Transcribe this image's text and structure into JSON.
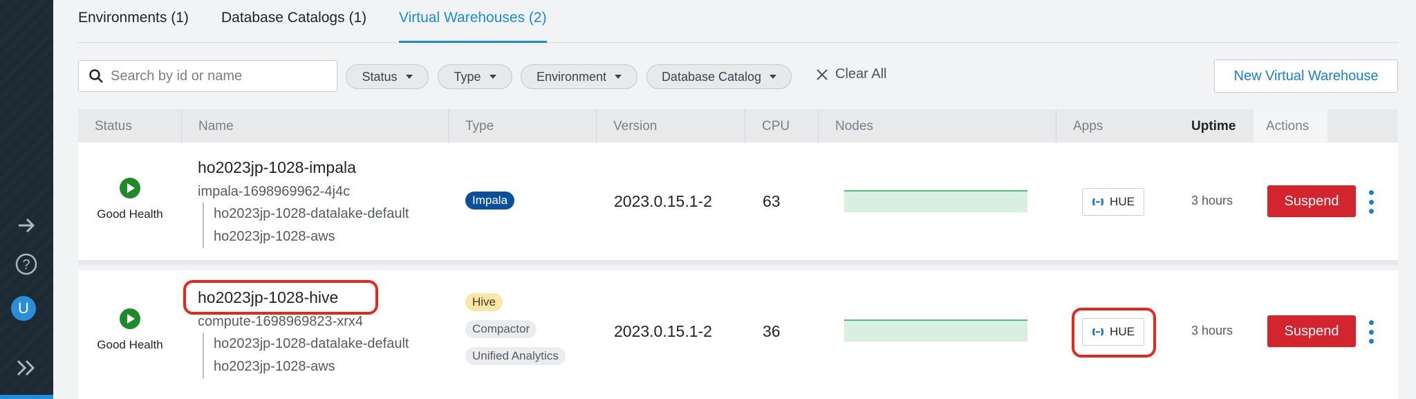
{
  "tabs": [
    "Environments (1)",
    "Database Catalogs (1)",
    "Virtual Warehouses (2)"
  ],
  "search": {
    "placeholder": "Search by id or name"
  },
  "filters": [
    "Status",
    "Type",
    "Environment",
    "Database Catalog"
  ],
  "clear_all_label": "Clear All",
  "new_vw_label": "New Virtual Warehouse",
  "columns": [
    "Status",
    "Name",
    "Type",
    "Version",
    "CPU",
    "Nodes",
    "Apps",
    "Uptime",
    "Actions"
  ],
  "rows": [
    {
      "health": "Good Health",
      "name": "ho2023jp-1028-impala",
      "id": "impala-1698969962-4j4c",
      "links": [
        "ho2023jp-1028-datalake-default",
        "ho2023jp-1028-aws"
      ],
      "types": [
        "Impala"
      ],
      "version": "2023.0.15.1-2",
      "cpu": "63",
      "app": "HUE",
      "uptime": "3 hours",
      "action": "Suspend"
    },
    {
      "health": "Good Health",
      "name": "ho2023jp-1028-hive",
      "id": "compute-1698969823-xrx4",
      "links": [
        "ho2023jp-1028-datalake-default",
        "ho2023jp-1028-aws"
      ],
      "types": [
        "Hive",
        "Compactor",
        "Unified Analytics"
      ],
      "version": "2023.0.15.1-2",
      "cpu": "36",
      "app": "HUE",
      "uptime": "3 hours",
      "action": "Suspend"
    }
  ],
  "avatar_initial": "U",
  "colors": {
    "accent": "#1a8be0",
    "danger": "#d3252d",
    "highlight": "#e8261a",
    "health": "#1f8a2a"
  }
}
